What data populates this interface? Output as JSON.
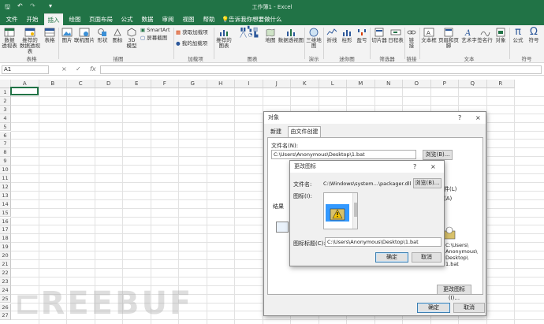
{
  "titlebar": {
    "save_icon": "save-icon",
    "undo_icon": "undo-icon",
    "redo_icon": "redo-icon",
    "customize_icon": "customize-icon",
    "title": "工作簿1 - Excel",
    "glyph_save": "🖫",
    "glyph_undo": "↶",
    "glyph_redo": "↷",
    "glyph_customize": "▾"
  },
  "tabs": [
    {
      "label": "文件"
    },
    {
      "label": "开始"
    },
    {
      "label": "插入"
    },
    {
      "label": "绘图"
    },
    {
      "label": "页面布局"
    },
    {
      "label": "公式"
    },
    {
      "label": "数据"
    },
    {
      "label": "审阅"
    },
    {
      "label": "视图"
    },
    {
      "label": "帮助"
    }
  ],
  "tellme": "告诉我你想要做什么",
  "ribbon": {
    "pivot": "数据\n透视表",
    "rec_pivot": "推荐的\n数据透视表",
    "table": "表格",
    "picture": "图片",
    "online_picture": "联机图片",
    "shapes": "形状",
    "icons": "图标",
    "model3d": "3D\n模型",
    "smartart": "SmartArt",
    "screenshot": "屏幕截图",
    "get_addins": "获取加载项",
    "my_addins": "我的加载项",
    "rec_charts": "推荐的\n图表",
    "maps": "地图",
    "pivot_chart": "数据透视图",
    "map3d": "三维地\n图",
    "line": "折线",
    "column": "柱形",
    "winloss": "盈亏",
    "slicer": "切片器",
    "timeline": "日程表",
    "link": "链\n接",
    "textbox": "文本框",
    "header_footer": "页眉和页脚",
    "wordart": "艺术字",
    "signature": "签名行",
    "object": "对象",
    "formula": "公式",
    "symbol": "符号",
    "groups": {
      "tables": "表格",
      "illustrations": "插图",
      "addins": "加载项",
      "charts": "图表",
      "tours": "演示",
      "sparklines": "迷你图",
      "filters": "筛选器",
      "links": "链接",
      "text": "文本",
      "symbols": "符号"
    }
  },
  "formula_bar": {
    "name_box": "A1",
    "cancel": "×",
    "enter": "✓",
    "fx": "fx",
    "content": ""
  },
  "columns": [
    "A",
    "B",
    "C",
    "D",
    "E",
    "F",
    "G",
    "H",
    "I",
    "J",
    "K",
    "L",
    "M",
    "N",
    "O",
    "P",
    "Q",
    "R"
  ],
  "rows": [
    "1",
    "2",
    "3",
    "4",
    "5",
    "6",
    "7",
    "8",
    "9",
    "10",
    "11",
    "12",
    "13",
    "14",
    "15",
    "16",
    "17",
    "18",
    "19",
    "20",
    "21",
    "22",
    "23",
    "24",
    "25",
    "26",
    "27"
  ],
  "object_dialog": {
    "title": "对象",
    "help": "?",
    "close": "×",
    "tab_new": "新建",
    "tab_from_file": "由文件创建",
    "filename_label": "文件名(N):",
    "filename_value": "C:\\Users\\Anonymous\\Desktop\\1.bat",
    "browse": "浏览(B)...",
    "link_to_file": "文件(L)",
    "display_as_icon": "示(A)",
    "result_label": "结果",
    "preview_caption": "C:\\Users\\\nAnonymous\\\nDesktop\\\n1.bat",
    "change_icon": "更改图标(I)...",
    "ok": "确定",
    "cancel": "取消"
  },
  "change_icon_dialog": {
    "title": "更改图标",
    "help": "?",
    "close": "×",
    "file_label": "文件名:",
    "file_value": "C:\\Windows\\system...\\packager.dll",
    "browse": "浏览(B)...",
    "icon_label": "图标(I):",
    "caption_label": "图标标题(C):",
    "caption_value": "C:\\Users\\Anonymous\\Desktop\\1.bat",
    "ok": "确定",
    "cancel": "取消"
  },
  "watermark": "REEBUF"
}
